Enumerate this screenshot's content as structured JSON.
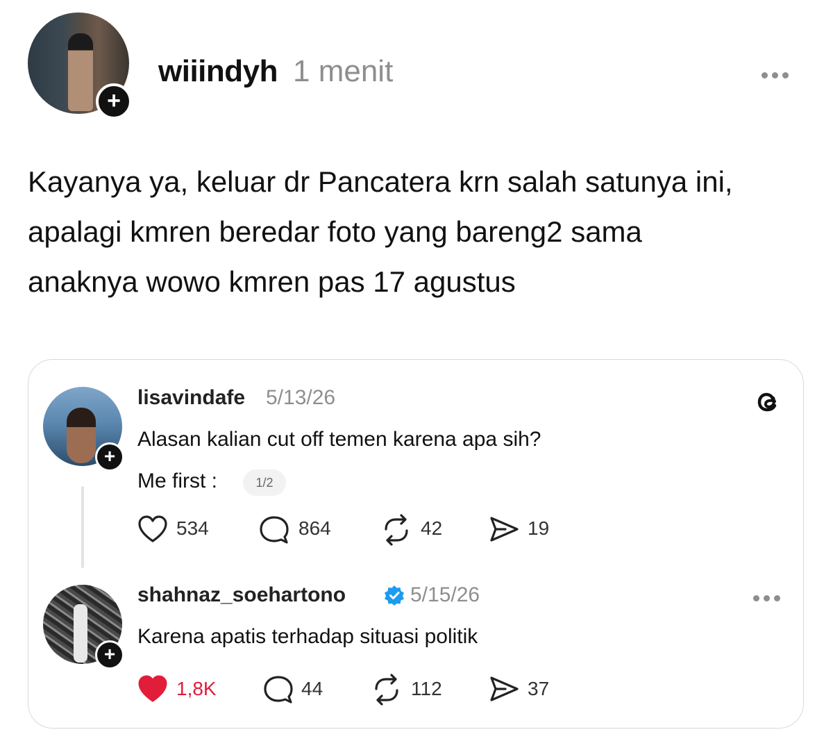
{
  "post": {
    "username": "wiiindyh",
    "time": "1 menit",
    "text": "Kayanya ya, keluar dr Pancatera krn salah satunya ini, apalagi kmren beredar foto yang bareng2 sama anaknya wowo kmren pas 17 agustus",
    "follow_icon": "plus-icon",
    "more_icon": "more-icon"
  },
  "quote": {
    "logo_icon": "threads-icon",
    "first": {
      "username": "lisavindafe",
      "date": "5/13/26",
      "line1": "Alasan kalian cut off temen karena apa sih?",
      "line2": "Me first :",
      "page": "1/2",
      "likes": "534",
      "replies": "864",
      "reposts": "42",
      "shares": "19",
      "liked": false
    },
    "reply": {
      "username": "shahnaz_soehartono",
      "verified": true,
      "date": "5/15/26",
      "text": "Karena apatis terhadap situasi politik",
      "likes": "1,8K",
      "replies": "44",
      "reposts": "112",
      "shares": "37",
      "liked": true,
      "like_color": "#e11d3a"
    }
  }
}
